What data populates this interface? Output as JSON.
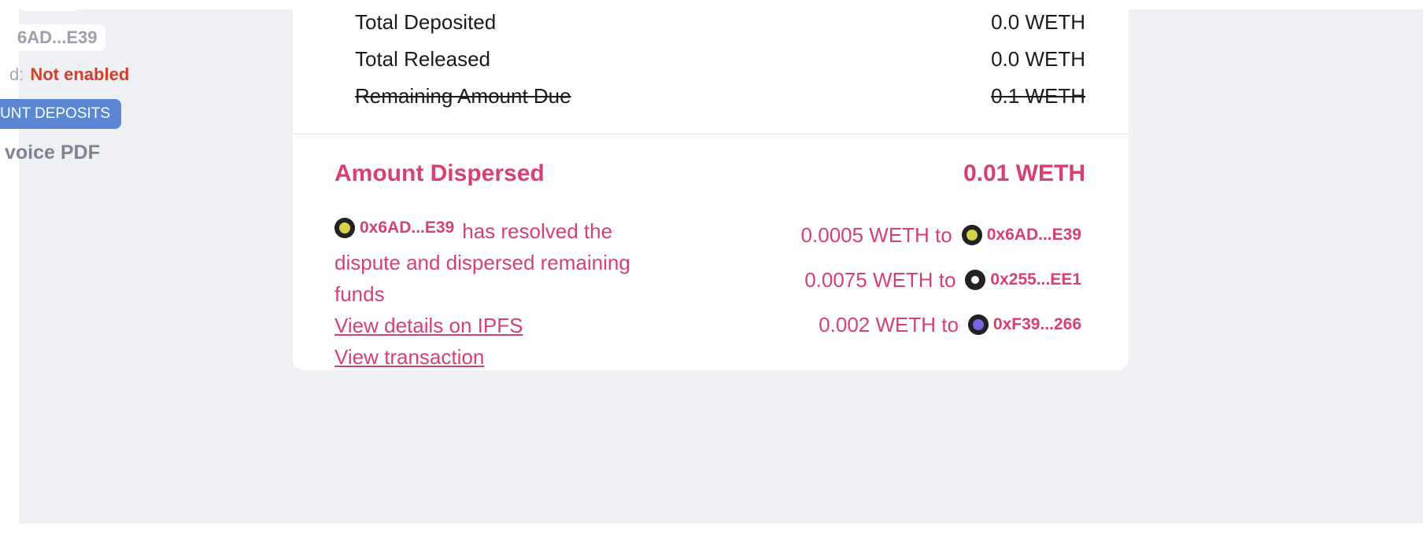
{
  "sidebar": {
    "address_chip": "6AD...E39",
    "verified_label": "d:",
    "verified_value": "Not enabled",
    "deposit_button": "UNT DEPOSITS",
    "invoice_pdf": "voice PDF"
  },
  "summary": {
    "rows": [
      {
        "label": "Total Deposited",
        "value": "0.0 WETH"
      },
      {
        "label": "Total Released",
        "value": "0.0 WETH"
      },
      {
        "label": "Remaining Amount Due",
        "value": "0.1 WETH"
      }
    ]
  },
  "dispersal": {
    "title": "Amount Dispersed",
    "total": "0.01 WETH",
    "resolver_address": "0x6AD...E39",
    "description": "has resolved the dispute and dispersed remaining funds",
    "ipfs_link": "View details on IPFS",
    "tx_link": "View transaction",
    "recipients": [
      {
        "amount": "0.0005 WETH to",
        "address": "0x6AD...E39",
        "avatar_color": "#d8d24a"
      },
      {
        "amount": "0.0075 WETH to",
        "address": "0x255...EE1",
        "avatar_color": "#ffffff"
      },
      {
        "amount": "0.002 WETH to",
        "address": "0xF39...266",
        "avatar_color": "#7a63e0"
      }
    ]
  },
  "colors": {
    "accent": "#d6416e",
    "danger": "#d0402c",
    "button": "#5a86d3"
  }
}
